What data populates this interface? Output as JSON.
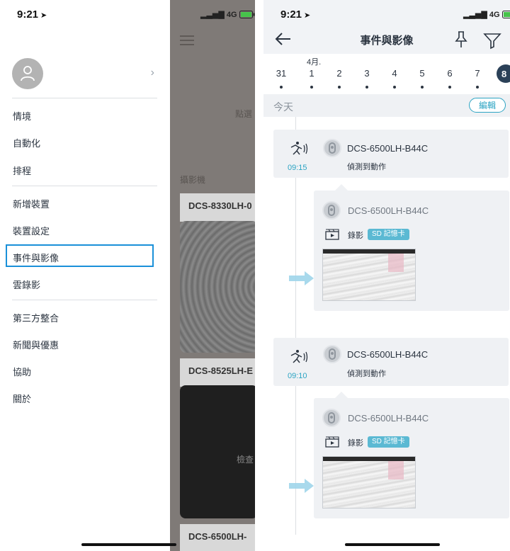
{
  "left_phone": {
    "status_time": "9:21",
    "network": "4G",
    "menu": [
      {
        "label": "情境"
      },
      {
        "label": "自動化"
      },
      {
        "label": "排程"
      },
      {
        "label": "新增裝置"
      },
      {
        "label": "裝置設定"
      },
      {
        "label": "事件與影像"
      },
      {
        "label": "雲錄影"
      },
      {
        "label": "第三方整合"
      },
      {
        "label": "新聞與優惠"
      },
      {
        "label": "協助"
      },
      {
        "label": "關於"
      }
    ],
    "highlighted_item": "事件與影像",
    "behind": {
      "partial_text_1": "點選",
      "section_label": "攝影機",
      "camera_1": "DCS-8330LH-0",
      "camera_2": "DCS-8525LH-E",
      "camera_3": "DCS-6500LH-",
      "partial_text_2": "檢查"
    }
  },
  "right_phone": {
    "status_time": "9:21",
    "network": "4G",
    "title": "事件與影像",
    "month_label": "4月.",
    "dates": [
      "31",
      "1",
      "2",
      "3",
      "4",
      "5",
      "6",
      "7"
    ],
    "selected_date": "8",
    "today_label": "今天",
    "edit_label": "編輯",
    "events": [
      {
        "time": "09:15",
        "device": "DCS-6500LH-B44C",
        "desc": "偵測到動作"
      },
      {
        "time": "09:10",
        "device": "DCS-6500LH-B44C",
        "desc": "偵測到動作"
      }
    ],
    "recordings": [
      {
        "device": "DCS-6500LH-B44C",
        "label": "錄影",
        "badge": "SD 記憶卡"
      },
      {
        "device": "DCS-6500LH-B44C",
        "label": "錄影",
        "badge": "SD 記憶卡"
      }
    ]
  },
  "colors": {
    "accent": "#2ca4c3",
    "highlight_border": "#1a90d9",
    "selected_date_bg": "#2b4158",
    "panel_bg": "#eff1f4"
  }
}
